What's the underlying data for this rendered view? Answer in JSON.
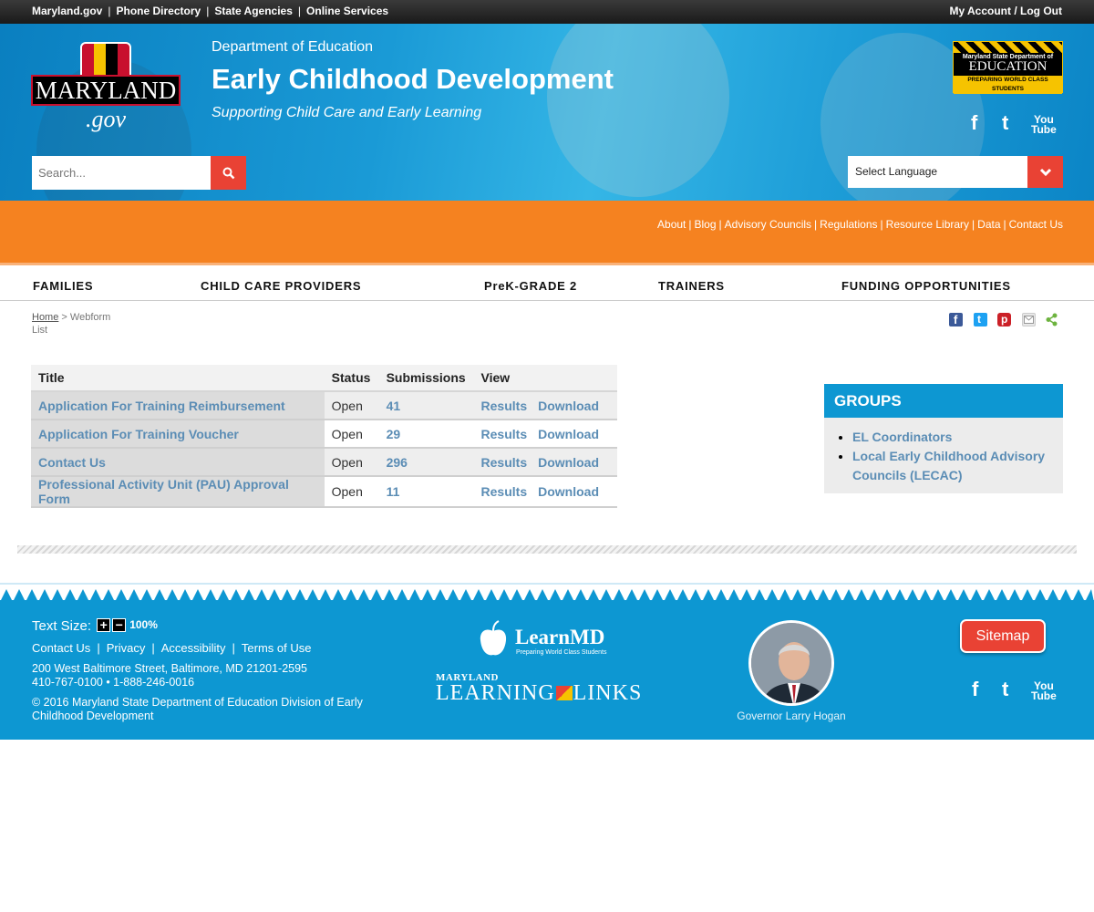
{
  "topbar": {
    "links": [
      "Maryland.gov",
      "Phone Directory",
      "State Agencies",
      "Online Services"
    ],
    "account": "My Account / Log Out"
  },
  "header": {
    "logo_text": "MARYLAND",
    "logo_gov": ".gov",
    "department": "Department of Education",
    "title": "Early Childhood Development",
    "tagline": "Supporting Child Care and Early Learning",
    "msde_logo": {
      "line1": "Maryland State Department of",
      "line2": "EDUCATION",
      "line3": "PREPARING WORLD CLASS STUDENTS"
    },
    "social": [
      "facebook-icon",
      "twitter-icon",
      "youtube-icon"
    ],
    "search_placeholder": "Search...",
    "language_label": "Select Language"
  },
  "utility_nav": {
    "links": [
      "About",
      "Blog",
      "Advisory Councils",
      "Regulations",
      "Resource Library",
      "Data",
      "Contact Us"
    ]
  },
  "main_nav": {
    "items": [
      "FAMILIES",
      "CHILD CARE PROVIDERS",
      "PreK-GRADE 2",
      "TRAINERS",
      "FUNDING OPPORTUNITIES"
    ]
  },
  "breadcrumb": {
    "home": "Home",
    "separator": ">",
    "current": "Webform List"
  },
  "share_icons": [
    "facebook-share-icon",
    "twitter-share-icon",
    "pinterest-share-icon",
    "email-share-icon",
    "share-icon"
  ],
  "webform_table": {
    "headers": [
      "Title",
      "Status",
      "Submissions",
      "View"
    ],
    "rows": [
      {
        "title": "Application For Training Reimbursement",
        "status": "Open",
        "submissions": "41",
        "results": "Results",
        "download": "Download"
      },
      {
        "title": "Application For Training Voucher",
        "status": "Open",
        "submissions": "29",
        "results": "Results",
        "download": "Download"
      },
      {
        "title": "Contact Us",
        "status": "Open",
        "submissions": "296",
        "results": "Results",
        "download": "Download"
      },
      {
        "title": "Professional Activity Unit (PAU) Approval Form",
        "status": "Open",
        "submissions": "11",
        "results": "Results",
        "download": "Download"
      }
    ]
  },
  "groups": {
    "heading": "GROUPS",
    "items": [
      "EL Coordinators",
      "Local Early Childhood Advisory Councils (LECAC)"
    ]
  },
  "footer": {
    "text_size_label": "Text Size:",
    "text_size_plus": "+",
    "text_size_minus": "−",
    "text_size_value": "100%",
    "links": [
      "Contact Us",
      "Privacy",
      "Accessibility",
      "Terms of Use"
    ],
    "address": "200 West Baltimore Street, Baltimore, MD 21201-2595",
    "phones": "410-767-0100 • 1-888-246-0016",
    "copyright": "© 2016 Maryland State Department of Education Division of Early Childhood Development",
    "learnmd_name": "LearnMD",
    "learnmd_sub": "Preparing World Class Students",
    "learning_links_top": "MARYLAND",
    "learning_links_left": "LEARNING",
    "learning_links_right": "LINKS",
    "governor": "Governor Larry Hogan",
    "sitemap": "Sitemap"
  },
  "colors": {
    "header_blue": "#0d97d2",
    "orange": "#f58220",
    "accent_red": "#e94234",
    "link_blue": "#5b8db5"
  }
}
